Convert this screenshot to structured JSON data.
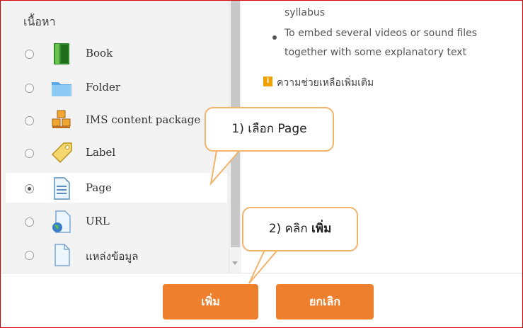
{
  "left_panel": {
    "section_title": "เนื้อหา",
    "items": [
      {
        "label": "Book",
        "icon": "book-icon",
        "selected": false
      },
      {
        "label": "Folder",
        "icon": "folder-icon",
        "selected": false
      },
      {
        "label": "IMS content package",
        "icon": "package-icon",
        "selected": false
      },
      {
        "label": "Label",
        "icon": "label-tag-icon",
        "selected": false
      },
      {
        "label": "Page",
        "icon": "page-icon",
        "selected": true
      },
      {
        "label": "URL",
        "icon": "url-globe-icon",
        "selected": false
      },
      {
        "label": "แหล่งข้อมูล",
        "icon": "file-icon",
        "selected": false
      }
    ]
  },
  "right_panel": {
    "line1": "syllabus",
    "line2": "To embed several videos or sound files",
    "line3": "together with some explanatory text",
    "help_text": "ความช่วยเหลือเพิ่มเติม"
  },
  "callouts": {
    "select_page": "1) เลือก Page",
    "click_add_prefix": "2) คลิก ",
    "click_add_bold": "เพิ่ม"
  },
  "buttons": {
    "add": "เพิ่ม",
    "cancel": "ยกเลิก"
  },
  "colors": {
    "accent": "#ee7f2d",
    "callout_border": "#f2b36c",
    "frame": "#d00000"
  }
}
